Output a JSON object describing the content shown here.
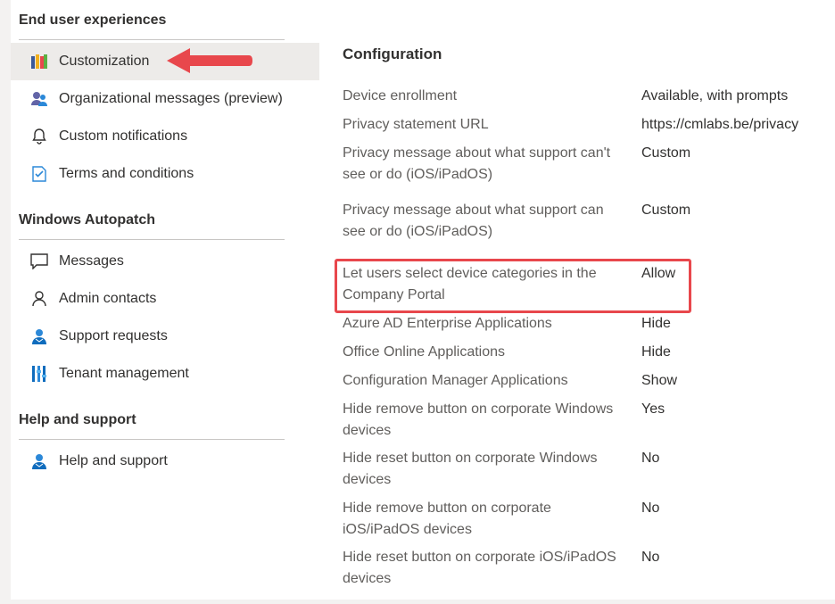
{
  "sidebar": {
    "groups": [
      {
        "title": "End user experiences",
        "items": [
          {
            "label": "Customization",
            "icon": "customization-icon"
          },
          {
            "label": "Organizational messages (preview)",
            "icon": "org-messages-icon"
          },
          {
            "label": "Custom notifications",
            "icon": "bell-icon"
          },
          {
            "label": "Terms and conditions",
            "icon": "terms-icon"
          }
        ]
      },
      {
        "title": "Windows Autopatch",
        "items": [
          {
            "label": "Messages",
            "icon": "message-icon"
          },
          {
            "label": "Admin contacts",
            "icon": "person-icon"
          },
          {
            "label": "Support requests",
            "icon": "support-person-icon"
          },
          {
            "label": "Tenant management",
            "icon": "tenant-bars-icon"
          }
        ]
      },
      {
        "title": "Help and support",
        "items": [
          {
            "label": "Help and support",
            "icon": "support-person-icon"
          }
        ]
      }
    ],
    "selected": "Customization"
  },
  "configuration": {
    "title": "Configuration",
    "rows": [
      {
        "label": "Device enrollment",
        "value": "Available, with prompts"
      },
      {
        "label": "Privacy statement URL",
        "value": "https://cmlabs.be/privacy"
      },
      {
        "label": "Privacy message about what support can't see or do (iOS/iPadOS)",
        "value": "Custom"
      },
      {
        "label": "Privacy message about what support can see or do (iOS/iPadOS)",
        "value": "Custom"
      },
      {
        "label": "Let users select device categories in the Company Portal",
        "value": "Allow"
      },
      {
        "label": "Azure AD Enterprise Applications",
        "value": "Hide"
      },
      {
        "label": "Office Online Applications",
        "value": "Hide"
      },
      {
        "label": "Configuration Manager Applications",
        "value": "Show"
      },
      {
        "label": "Hide remove button on corporate Windows devices",
        "value": "Yes"
      },
      {
        "label": "Hide reset button on corporate Windows devices",
        "value": "No"
      },
      {
        "label": "Hide remove button on corporate iOS/iPadOS devices",
        "value": "No"
      },
      {
        "label": "Hide reset button on corporate iOS/iPadOS devices",
        "value": "No"
      }
    ]
  },
  "colors": {
    "accent_red": "#e8474c",
    "selected_bg": "#edebe9",
    "label_gray": "#605e5c"
  }
}
